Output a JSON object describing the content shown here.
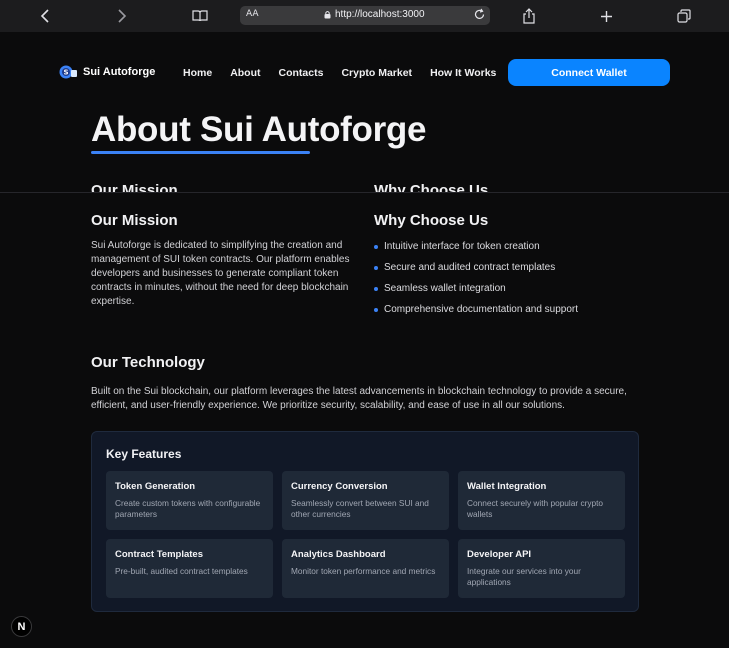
{
  "browser": {
    "reader_label": "AA",
    "url": "http://localhost:3000"
  },
  "nav": {
    "brand": "Sui Autoforge",
    "links": [
      "Home",
      "About",
      "Contacts",
      "Crypto Market",
      "How It Works"
    ],
    "connect_label": "Connect Wallet",
    "accent": "#0a84ff"
  },
  "page": {
    "title": "About Sui Autoforge",
    "mission": {
      "heading": "Our Mission",
      "text": "Sui Autoforge is dedicated to simplifying the creation and management of SUI token contracts. Our platform enables developers and businesses to generate compliant token contracts in minutes, without the need for deep blockchain expertise."
    },
    "why": {
      "heading": "Why Choose Us",
      "items": [
        "Intuitive interface for token creation",
        "Secure and audited contract templates",
        "Seamless wallet integration",
        "Comprehensive documentation and support"
      ]
    },
    "technology": {
      "heading": "Our Technology",
      "text": "Built on the Sui blockchain, our platform leverages the latest advancements in blockchain technology to provide a secure, efficient, and user-friendly experience. We prioritize security, scalability, and ease of use in all our solutions."
    },
    "features": {
      "heading": "Key Features",
      "cards": [
        {
          "title": "Token Generation",
          "desc": "Create custom tokens with configurable parameters"
        },
        {
          "title": "Currency Conversion",
          "desc": "Seamlessly convert between SUI and other currencies"
        },
        {
          "title": "Wallet Integration",
          "desc": "Connect securely with popular crypto wallets"
        },
        {
          "title": "Contract Templates",
          "desc": "Pre-built, audited contract templates"
        },
        {
          "title": "Analytics Dashboard",
          "desc": "Monitor token performance and metrics"
        },
        {
          "title": "Developer API",
          "desc": "Integrate our services into your applications"
        }
      ]
    }
  },
  "dev_badge": "N"
}
